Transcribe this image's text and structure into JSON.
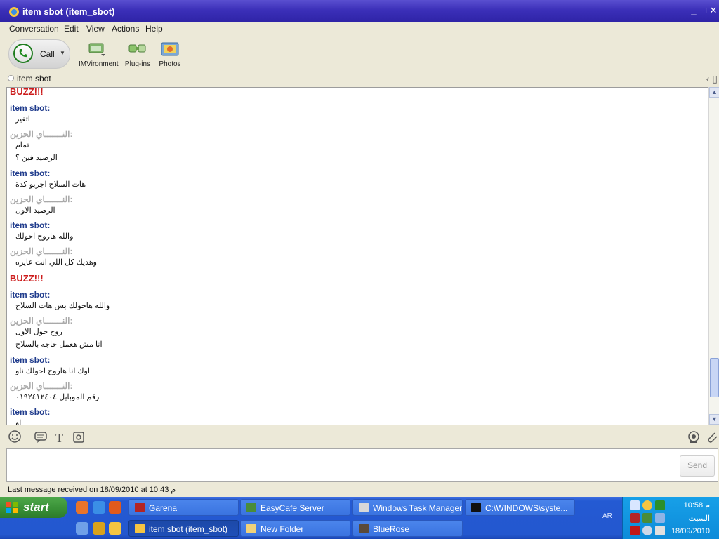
{
  "window": {
    "title": "item sbot (item_sbot)",
    "controls": [
      "_",
      "□",
      "✕"
    ]
  },
  "menu": [
    "Conversation",
    "Edit",
    "View",
    "Actions",
    "Help"
  ],
  "toolbar": {
    "call_label": "Call",
    "tools": [
      {
        "label": "IMVironment",
        "icon": "imvironment-icon"
      },
      {
        "label": "Plug-ins",
        "icon": "plugins-icon"
      },
      {
        "label": "Photos",
        "icon": "photos-icon"
      }
    ]
  },
  "buddy": {
    "name": "item sbot"
  },
  "conversation": {
    "buzz_label": "BUZZ!!!",
    "me_name": "item sbot:",
    "other_name": "النـــــــاي الحزين:",
    "entries": [
      {
        "type": "buzz",
        "text": "BUZZ!!!"
      },
      {
        "type": "sender",
        "who": "me",
        "text": "item sbot:"
      },
      {
        "type": "line",
        "text": "اتغير"
      },
      {
        "type": "sender",
        "who": "other",
        "text": "النـــــــاي الحزين:"
      },
      {
        "type": "line",
        "text": "تمام"
      },
      {
        "type": "line",
        "text": "الرصيد فين ؟"
      },
      {
        "type": "sender",
        "who": "me",
        "text": "item sbot:"
      },
      {
        "type": "line",
        "text": "هات السلاح اجربو كدة"
      },
      {
        "type": "sender",
        "who": "other",
        "text": "النـــــــاي الحزين:"
      },
      {
        "type": "line",
        "text": "الرصيد الاول"
      },
      {
        "type": "sender",
        "who": "me",
        "text": "item sbot:"
      },
      {
        "type": "line",
        "text": "والله هاروح احولك"
      },
      {
        "type": "sender",
        "who": "other",
        "text": "النـــــــاي الحزين:"
      },
      {
        "type": "line",
        "text": "وهديك كل اللي انت عايزه"
      },
      {
        "type": "buzz",
        "text": "BUZZ!!!"
      },
      {
        "type": "sender",
        "who": "me",
        "text": "item sbot:"
      },
      {
        "type": "line",
        "text": "والله هاحولك بس هات السلاح"
      },
      {
        "type": "sender",
        "who": "other",
        "text": "النـــــــاي الحزين:"
      },
      {
        "type": "line",
        "text": "روح حول الاول"
      },
      {
        "type": "line",
        "text": "انا مش هعمل حاجه بالسلاح"
      },
      {
        "type": "sender",
        "who": "me",
        "text": "item sbot:"
      },
      {
        "type": "line",
        "text": "اوك انا هاروح احولك ناو"
      },
      {
        "type": "sender",
        "who": "other",
        "text": "النـــــــاي الحزين:"
      },
      {
        "type": "line",
        "text": "رقم الموبايل ٠١٩٢٤١٢٤٠٤"
      },
      {
        "type": "sender",
        "who": "me",
        "text": "item sbot:"
      },
      {
        "type": "line",
        "text": "او"
      }
    ]
  },
  "input": {
    "value": "",
    "send_label": "Send"
  },
  "status": {
    "text": "Last message received on 18/09/2010 at 10:43 م"
  },
  "taskbar": {
    "start_label": "start",
    "row1": [
      {
        "label": "Garena",
        "active": false
      },
      {
        "label": "EasyCafe Server",
        "active": false
      },
      {
        "label": "Windows Task Manager",
        "active": false
      },
      {
        "label": "C:\\WINDOWS\\syste...",
        "active": false
      }
    ],
    "row2": [
      {
        "label": "item sbot (item_sbot)",
        "active": true
      },
      {
        "label": "New Folder",
        "active": false
      },
      {
        "label": "BlueRose",
        "active": false
      }
    ],
    "language": "AR",
    "clock": {
      "time": "10:58 م",
      "day": "السبت",
      "date": "18/09/2010"
    }
  },
  "colors": {
    "title_bar": "#3b2fb8",
    "buzz": "#cc1b1b",
    "me_name": "#1f3b8c",
    "other_name": "#a9a9a9",
    "taskbar": "#245ad3",
    "tray": "#0d8bd9",
    "start": "#378f35"
  }
}
